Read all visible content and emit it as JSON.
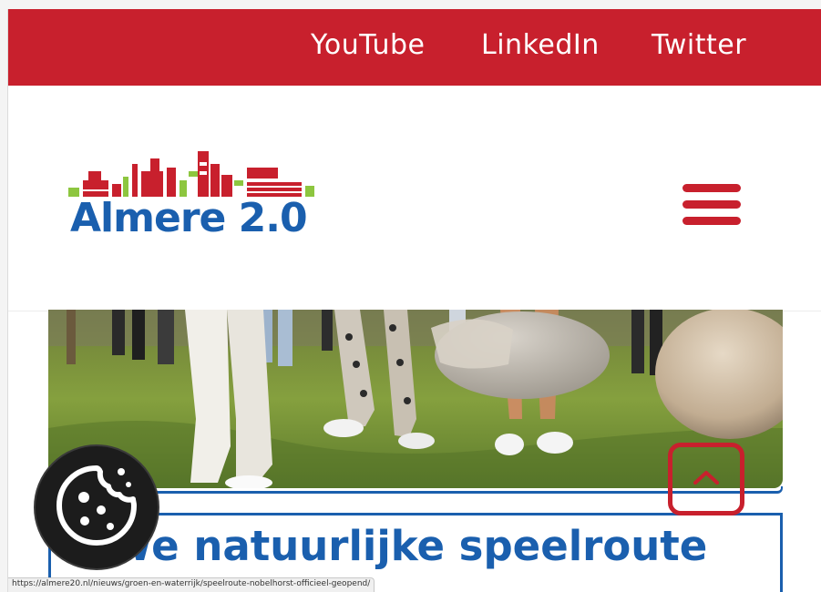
{
  "top_bar": {
    "background": "#c8202d",
    "links": [
      {
        "label": "YouTube"
      },
      {
        "label": "LinkedIn"
      },
      {
        "label": "Twitter"
      }
    ]
  },
  "header": {
    "logo_text": "Almere 2.0",
    "menu_icon": "hamburger-menu-icon"
  },
  "hero_image": {
    "subject": "children-playing-on-grass-near-boulders"
  },
  "article": {
    "title_visible": "euwe natuurlijke speelroute"
  },
  "cookie_button": {
    "icon": "cookie-icon"
  },
  "back_to_top": {
    "icon": "chevron-up-icon"
  },
  "status_bar": {
    "url": "https://almere20.nl/nieuws/groen-en-waterrijk/speelroute-nobelhorst-officieel-geopend/"
  },
  "colors": {
    "brand_red": "#c8202d",
    "brand_blue": "#1a5fae",
    "logo_green": "#8dc63f"
  }
}
